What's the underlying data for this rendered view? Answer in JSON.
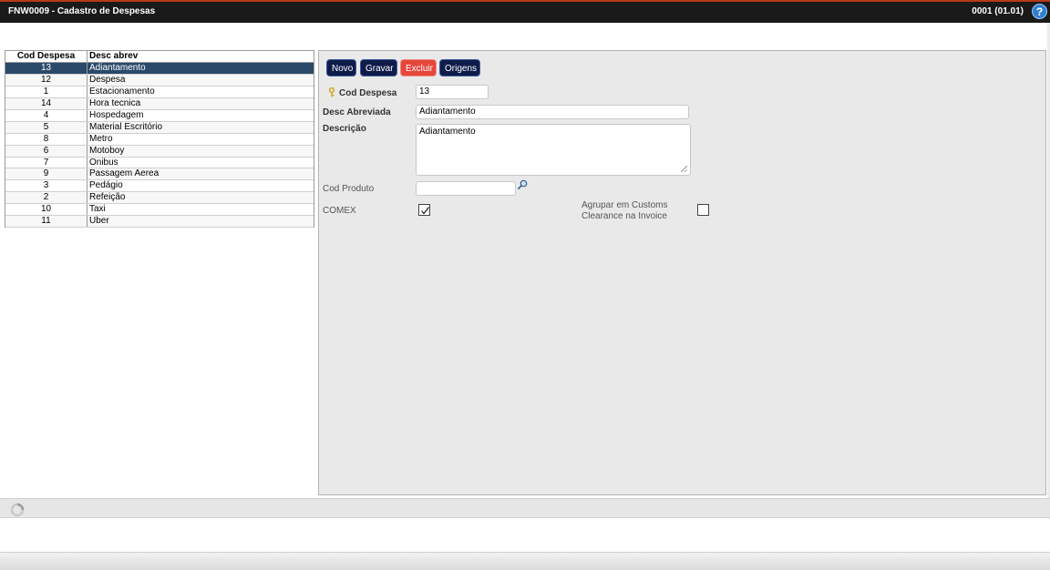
{
  "window": {
    "title": "FNW0009 - Cadastro de Despesas",
    "company": "0001 (01.01)",
    "help_glyph": "?"
  },
  "grid": {
    "headers": [
      "Cod Despesa",
      "Desc abrev"
    ],
    "rows": [
      [
        "13",
        "Adiantamento"
      ],
      [
        "12",
        "Despesa"
      ],
      [
        "1",
        "Estacionamento"
      ],
      [
        "14",
        "Hora tecnica"
      ],
      [
        "4",
        "Hospedagem"
      ],
      [
        "5",
        "Material Escritório"
      ],
      [
        "8",
        "Metro"
      ],
      [
        "6",
        "Motoboy"
      ],
      [
        "7",
        "Onibus"
      ],
      [
        "9",
        "Passagem Aerea"
      ],
      [
        "3",
        "Pedágio"
      ],
      [
        "2",
        "Refeição"
      ],
      [
        "10",
        "Taxi"
      ],
      [
        "11",
        "Uber"
      ]
    ],
    "selected_index": 0
  },
  "toolbar": {
    "novo": "Novo",
    "gravar": "Gravar",
    "excluir": "Excluir",
    "origens": "Origens"
  },
  "form": {
    "cod_despesa_label": "Cod Despesa",
    "cod_despesa_value": "13",
    "desc_abrev_label": "Desc Abreviada",
    "desc_abrev_value": "Adiantamento",
    "descricao_label": "Descrição",
    "descricao_value": "Adiantamento",
    "cod_produto_label": "Cod Produto",
    "cod_produto_value": "",
    "comex_label": "COMEX",
    "comex_checked": true,
    "agrupar_label_line1": "Agrupar em Customs",
    "agrupar_label_line2": "Clearance na Invoice",
    "agrupar_checked": false
  },
  "colors": {
    "titlebar": "#1a1a1a",
    "button": "#0f1c4a",
    "danger_button": "#e6463a",
    "selected_row": "#2b4a6a"
  },
  "icons": {
    "key": "key-icon",
    "search": "search-icon",
    "help": "help-icon",
    "loader": "loader-icon"
  }
}
